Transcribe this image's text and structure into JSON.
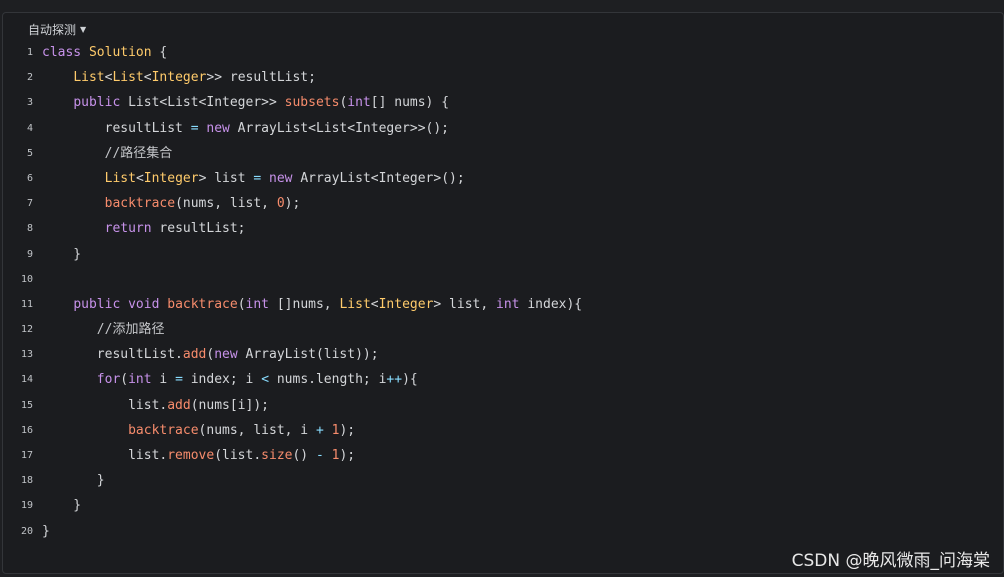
{
  "language_selector": {
    "label": "自动探测"
  },
  "code_lines": [
    {
      "n": "1",
      "tokens": [
        [
          "k",
          "class"
        ],
        [
          "p",
          " "
        ],
        [
          "t",
          "Solution"
        ],
        [
          "p",
          " {"
        ]
      ]
    },
    {
      "n": "2",
      "tokens": [
        [
          "p",
          "    "
        ],
        [
          "t",
          "List"
        ],
        [
          "p",
          "<"
        ],
        [
          "t",
          "List"
        ],
        [
          "p",
          "<"
        ],
        [
          "t",
          "Integer"
        ],
        [
          "p",
          ">> resultList;"
        ]
      ]
    },
    {
      "n": "3",
      "tokens": [
        [
          "p",
          "    "
        ],
        [
          "k",
          "public"
        ],
        [
          "p",
          " List<List<Integer>> "
        ],
        [
          "f",
          "subsets"
        ],
        [
          "p",
          "("
        ],
        [
          "k",
          "int"
        ],
        [
          "p",
          "[] nums) {"
        ]
      ]
    },
    {
      "n": "4",
      "tokens": [
        [
          "p",
          "        resultList "
        ],
        [
          "o",
          "="
        ],
        [
          "p",
          " "
        ],
        [
          "k",
          "new"
        ],
        [
          "p",
          " ArrayList<List<Integer>>();"
        ]
      ]
    },
    {
      "n": "5",
      "tokens": [
        [
          "c",
          "        //路径集合"
        ]
      ]
    },
    {
      "n": "6",
      "tokens": [
        [
          "p",
          "        "
        ],
        [
          "t",
          "List"
        ],
        [
          "p",
          "<"
        ],
        [
          "t",
          "Integer"
        ],
        [
          "p",
          "> list "
        ],
        [
          "o",
          "="
        ],
        [
          "p",
          " "
        ],
        [
          "k",
          "new"
        ],
        [
          "p",
          " ArrayList<Integer>();"
        ]
      ]
    },
    {
      "n": "7",
      "tokens": [
        [
          "p",
          "        "
        ],
        [
          "f",
          "backtrace"
        ],
        [
          "p",
          "(nums, list, "
        ],
        [
          "n",
          "0"
        ],
        [
          "p",
          ");"
        ]
      ]
    },
    {
      "n": "8",
      "tokens": [
        [
          "p",
          "        "
        ],
        [
          "k",
          "return"
        ],
        [
          "p",
          " resultList;"
        ]
      ]
    },
    {
      "n": "9",
      "tokens": [
        [
          "p",
          "    }"
        ]
      ]
    },
    {
      "n": "10",
      "tokens": [
        [
          "p",
          ""
        ]
      ]
    },
    {
      "n": "11",
      "tokens": [
        [
          "p",
          "    "
        ],
        [
          "k",
          "public"
        ],
        [
          "p",
          " "
        ],
        [
          "k",
          "void"
        ],
        [
          "p",
          " "
        ],
        [
          "f",
          "backtrace"
        ],
        [
          "p",
          "("
        ],
        [
          "k",
          "int"
        ],
        [
          "p",
          " []nums, "
        ],
        [
          "t",
          "List"
        ],
        [
          "p",
          "<"
        ],
        [
          "t",
          "Integer"
        ],
        [
          "p",
          "> list, "
        ],
        [
          "k",
          "int"
        ],
        [
          "p",
          " index){"
        ]
      ]
    },
    {
      "n": "12",
      "tokens": [
        [
          "c",
          "       //添加路径"
        ]
      ]
    },
    {
      "n": "13",
      "tokens": [
        [
          "p",
          "       resultList."
        ],
        [
          "f",
          "add"
        ],
        [
          "p",
          "("
        ],
        [
          "k",
          "new"
        ],
        [
          "p",
          " ArrayList(list));"
        ]
      ]
    },
    {
      "n": "14",
      "tokens": [
        [
          "p",
          "       "
        ],
        [
          "k",
          "for"
        ],
        [
          "p",
          "("
        ],
        [
          "k",
          "int"
        ],
        [
          "p",
          " i "
        ],
        [
          "o",
          "="
        ],
        [
          "p",
          " index; i "
        ],
        [
          "o",
          "<"
        ],
        [
          "p",
          " nums.length; i"
        ],
        [
          "o",
          "++"
        ],
        [
          "p",
          "){"
        ]
      ]
    },
    {
      "n": "15",
      "tokens": [
        [
          "p",
          "           list."
        ],
        [
          "f",
          "add"
        ],
        [
          "p",
          "(nums[i]);"
        ]
      ]
    },
    {
      "n": "16",
      "tokens": [
        [
          "p",
          "           "
        ],
        [
          "f",
          "backtrace"
        ],
        [
          "p",
          "(nums, list, i "
        ],
        [
          "o",
          "+"
        ],
        [
          "p",
          " "
        ],
        [
          "n",
          "1"
        ],
        [
          "p",
          ");"
        ]
      ]
    },
    {
      "n": "17",
      "tokens": [
        [
          "p",
          "           list."
        ],
        [
          "f",
          "remove"
        ],
        [
          "p",
          "(list."
        ],
        [
          "f",
          "size"
        ],
        [
          "p",
          "() "
        ],
        [
          "o",
          "-"
        ],
        [
          "p",
          " "
        ],
        [
          "n",
          "1"
        ],
        [
          "p",
          ");"
        ]
      ]
    },
    {
      "n": "18",
      "tokens": [
        [
          "p",
          "       }"
        ]
      ]
    },
    {
      "n": "19",
      "tokens": [
        [
          "p",
          "    }"
        ]
      ]
    },
    {
      "n": "20",
      "tokens": [
        [
          "p",
          "}"
        ]
      ]
    }
  ],
  "watermark": "CSDN @晚风微雨_问海棠",
  "colors": {
    "keyword": "#c792ea",
    "type": "#ffcb6b",
    "function": "#f78c6c",
    "number": "#f78c6c",
    "operator": "#89ddff",
    "text": "#d4d6d9",
    "background": "#1b1c1f"
  }
}
